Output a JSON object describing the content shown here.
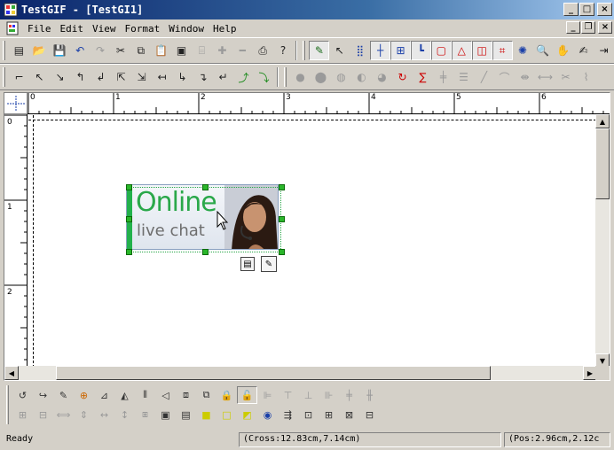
{
  "window": {
    "title": "TestGIF - [TestGI1]"
  },
  "menu": [
    "File",
    "Edit",
    "View",
    "Format",
    "Window",
    "Help"
  ],
  "toolbar1": {
    "left_icons": [
      "new-icon",
      "open-icon",
      "save-icon",
      "undo-icon",
      "redo-icon",
      "cut-icon",
      "copy-icon",
      "paste-icon",
      "paste-special-icon",
      "properties-icon",
      "plus-icon",
      "minus-icon",
      "print-icon",
      "help-icon"
    ],
    "right_icons": [
      "select-tool-icon",
      "pointer-tool-icon",
      "grid-icon",
      "crosshair-icon",
      "table-icon",
      "corner-icon",
      "rectangle-icon",
      "triangle-icon",
      "shape-icon",
      "frame-icon",
      "gear-icon",
      "zoom-icon",
      "hand-icon",
      "note-icon",
      "exit-icon"
    ]
  },
  "toolbar2": {
    "left_icons": [
      "connector-1-icon",
      "connector-2-icon",
      "connector-3-icon",
      "connector-4-icon",
      "connector-5-icon",
      "connector-6-icon",
      "connector-7-icon",
      "connector-8-icon",
      "connector-9-icon",
      "connector-10-icon",
      "connector-11-icon",
      "connector-12-icon",
      "connector-13-icon"
    ],
    "right_icons": [
      "blob-1-icon",
      "blob-2-icon",
      "blob-3-icon",
      "blob-4-icon",
      "blob-5-icon",
      "rotate-icon",
      "warp-icon",
      "split-icon",
      "align-center-icon",
      "line-tool-icon",
      "arc-tool-icon",
      "distribute-icon",
      "mirror-icon",
      "scissors-icon",
      "more-icon"
    ]
  },
  "ruler": {
    "h_labels": [
      "0",
      "1",
      "2",
      "3",
      "4",
      "5",
      "6"
    ],
    "v_labels": [
      "0",
      "1",
      "2"
    ]
  },
  "banner": {
    "line1": "Online",
    "line2": "live chat"
  },
  "bottom_toolbar1": [
    "rotate-ccw-icon",
    "rotate-edit-icon",
    "edit-node-icon",
    "merge-icon",
    "flip-h-icon",
    "flip-v-icon",
    "mirror-icon",
    "triangle-left-icon",
    "group-icon",
    "ungroup-icon",
    "lock-icon",
    "unlock-icon",
    "align-left-icon",
    "align-top-icon",
    "align-bottom-icon",
    "align-right-icon",
    "align-middle-icon",
    "align-center-icon"
  ],
  "bottom_toolbar2": [
    "space-h-icon",
    "space-v-icon",
    "width-icon",
    "height-icon",
    "same-width-icon",
    "same-height-icon",
    "same-size-icon",
    "bring-front-icon",
    "send-back-icon",
    "forward-icon",
    "backward-icon",
    "fill-icon",
    "color-icon",
    "arrange-icon",
    "fit-icon",
    "tile-icon",
    "stack-icon",
    "order-icon"
  ],
  "status": {
    "ready": "Ready",
    "cross": "(Cross:12.83cm,7.14cm)",
    "pos": "(Pos:2.96cm,2.12c"
  }
}
